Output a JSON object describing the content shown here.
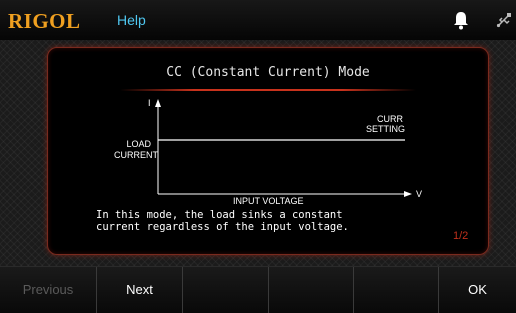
{
  "header": {
    "brand": "RIGOL",
    "title": "Help",
    "icons": [
      "bell-icon",
      "usb-icon"
    ]
  },
  "dialog": {
    "title": "CC (Constant Current) Mode",
    "diagram": {
      "y_axis_label": "I",
      "x_axis_label": "INPUT VOLTAGE",
      "x_axis_unit": "V",
      "load_current_line1": "LOAD",
      "load_current_line2": "CURRENT",
      "setting_line1": "CURR",
      "setting_line2": "SETTING"
    },
    "description_line1": "In this mode, the load sinks a constant",
    "description_line2": "current regardless of the input voltage.",
    "page_indicator": "1/2"
  },
  "softkeys": {
    "previous": "Previous",
    "next": "Next",
    "ok": "OK"
  },
  "colors": {
    "brand": "#f0a020",
    "title": "#4fc7f0",
    "accent_red": "#c0301c",
    "disabled": "#5a5a5a"
  }
}
